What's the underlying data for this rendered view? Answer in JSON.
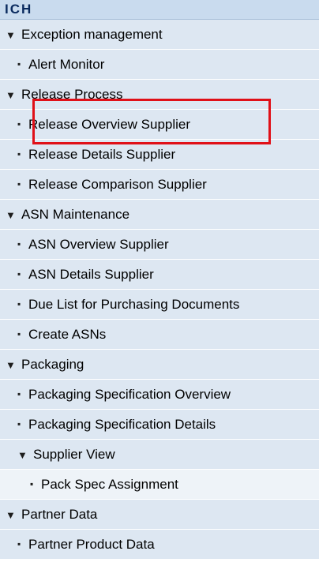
{
  "nav": {
    "title": "ICH",
    "rows": [
      {
        "kind": "section",
        "label": "Exception management"
      },
      {
        "kind": "item",
        "label": "Alert Monitor"
      },
      {
        "kind": "section",
        "label": "Release Process"
      },
      {
        "kind": "item",
        "label": "Release Overview Supplier"
      },
      {
        "kind": "item",
        "label": "Release Details Supplier"
      },
      {
        "kind": "item",
        "label": "Release Comparison Supplier"
      },
      {
        "kind": "section",
        "label": "ASN Maintenance"
      },
      {
        "kind": "item",
        "label": "ASN Overview Supplier"
      },
      {
        "kind": "item",
        "label": "ASN Details Supplier"
      },
      {
        "kind": "item",
        "label": "Due List for Purchasing Documents"
      },
      {
        "kind": "item",
        "label": "Create ASNs"
      },
      {
        "kind": "section",
        "label": "Packaging"
      },
      {
        "kind": "item",
        "label": "Packaging Specification Overview"
      },
      {
        "kind": "item",
        "label": "Packaging Specification Details"
      },
      {
        "kind": "subsection",
        "label": "Supplier View"
      },
      {
        "kind": "subitem",
        "label": "Pack Spec Assignment"
      },
      {
        "kind": "section",
        "label": "Partner Data"
      },
      {
        "kind": "item",
        "label": "Partner Product Data"
      }
    ],
    "highlighted_item": "Release Overview Supplier",
    "colors": {
      "header_bg": "#c9dbee",
      "row_bg": "#dde7f2",
      "subitem_bg": "#eef3f8",
      "highlight_border": "#e01018"
    }
  }
}
